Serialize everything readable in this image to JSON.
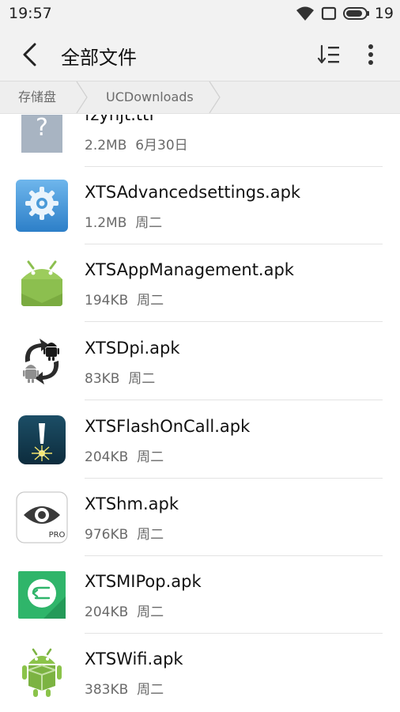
{
  "status_bar": {
    "time": "19:57",
    "battery_percent": "19",
    "icons": [
      "wifi-icon",
      "screen-icon",
      "battery-icon"
    ]
  },
  "app_bar": {
    "title": "全部文件",
    "icons": [
      "back-arrow-icon",
      "sort-list-icon",
      "more-vert-icon"
    ]
  },
  "breadcrumb": [
    "存储盘",
    "UCDownloads"
  ],
  "files": [
    {
      "name": "fzyhjt.ttf",
      "size": "2.2MB",
      "date": "6月30日",
      "icon": "unknown-file-icon"
    },
    {
      "name": "XTSAdvancedsettings.apk",
      "size": "1.2MB",
      "date": "周二",
      "icon": "gear-app-icon"
    },
    {
      "name": "XTSAppManagement.apk",
      "size": "194KB",
      "date": "周二",
      "icon": "android-app-icon"
    },
    {
      "name": "XTSDpi.apk",
      "size": "83KB",
      "date": "周二",
      "icon": "android-sync-icon"
    },
    {
      "name": "XTSFlashOnCall.apk",
      "size": "204KB",
      "date": "周二",
      "icon": "flash-app-icon"
    },
    {
      "name": "XTShm.apk",
      "size": "976KB",
      "date": "周二",
      "icon": "eye-pro-app-icon",
      "badge": "PRO"
    },
    {
      "name": "XTSMIPop.apk",
      "size": "204KB",
      "date": "周二",
      "icon": "mipop-app-icon"
    },
    {
      "name": "XTSWifi.apk",
      "size": "383KB",
      "date": "周二",
      "icon": "android-box-app-icon"
    }
  ],
  "colors": {
    "status_bg": "#f2f2f2",
    "breadcrumb_bg": "#eeeeee",
    "divider": "#e3e3e3",
    "meta_text": "#6a6a6a"
  }
}
